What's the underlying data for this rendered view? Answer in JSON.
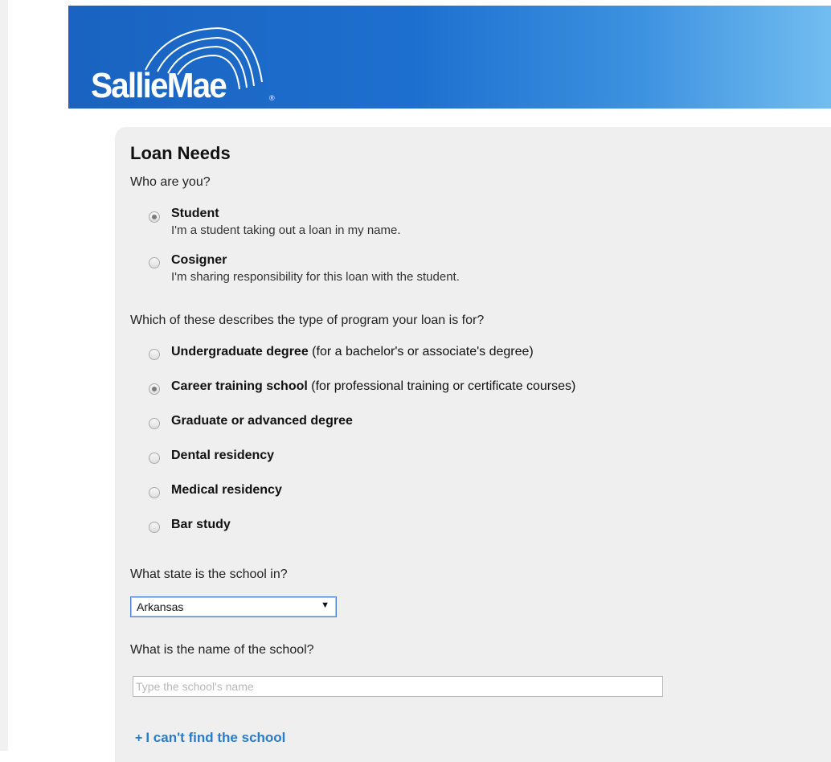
{
  "brand": {
    "logo_text": "SallieMae",
    "logo_mark": "®"
  },
  "form": {
    "title": "Loan Needs",
    "who_question": "Who are you?",
    "who_options": [
      {
        "label": "Student",
        "desc": "I'm a student taking out a loan in my name.",
        "checked": true
      },
      {
        "label": "Cosigner",
        "desc": "I'm sharing responsibility for this loan with the student.",
        "checked": false
      }
    ],
    "program_question": "Which of these describes the type of program your loan is for?",
    "program_options": [
      {
        "label": "Undergraduate degree",
        "note": " (for a bachelor's or associate's degree)",
        "checked": false
      },
      {
        "label": "Career training school",
        "note": " (for professional training or certificate courses)",
        "checked": true
      },
      {
        "label": "Graduate or advanced degree",
        "note": "",
        "checked": false
      },
      {
        "label": "Dental residency",
        "note": "",
        "checked": false
      },
      {
        "label": "Medical residency",
        "note": "",
        "checked": false
      },
      {
        "label": "Bar study",
        "note": "",
        "checked": false
      }
    ],
    "state_question": "What state is the school in?",
    "state_selected": "Arkansas",
    "school_question": "What is the name of the school?",
    "school_placeholder": "Type the school's name",
    "school_value": "",
    "cant_find_label": "I can't find the school",
    "cant_find_icon": "+"
  },
  "colors": {
    "header_start": "#1a63c0",
    "header_end": "#72bdf0",
    "link": "#2a7cc7",
    "panel": "#efefef"
  }
}
